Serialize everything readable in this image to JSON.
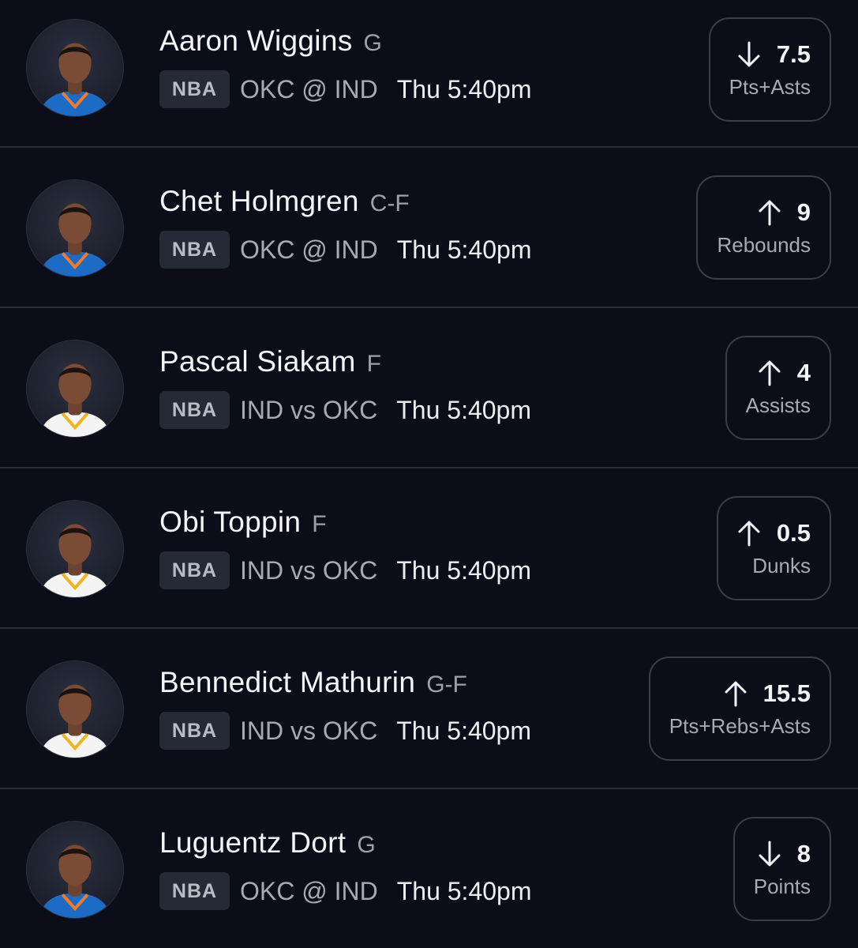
{
  "colors": {
    "background": "#0b0d18",
    "card_border": "#3a3d4a",
    "badge_bg": "#262936",
    "okc_jersey": "#1d6bc4",
    "ind_jersey": "#f4f4f4"
  },
  "players": [
    {
      "name": "Aaron Wiggins",
      "position": "G",
      "league": "NBA",
      "matchup": "OKC @ IND",
      "time": "Thu 5:40pm",
      "direction": "down",
      "arrow_icon": "arrow-down-icon",
      "value": "7.5",
      "stat": "Pts+Asts",
      "jersey": "okc"
    },
    {
      "name": "Chet Holmgren",
      "position": "C-F",
      "league": "NBA",
      "matchup": "OKC @ IND",
      "time": "Thu 5:40pm",
      "direction": "up",
      "arrow_icon": "arrow-up-icon",
      "value": "9",
      "stat": "Rebounds",
      "jersey": "okc"
    },
    {
      "name": "Pascal Siakam",
      "position": "F",
      "league": "NBA",
      "matchup": "IND vs OKC",
      "time": "Thu 5:40pm",
      "direction": "up",
      "arrow_icon": "arrow-up-icon",
      "value": "4",
      "stat": "Assists",
      "jersey": "ind"
    },
    {
      "name": "Obi Toppin",
      "position": "F",
      "league": "NBA",
      "matchup": "IND vs OKC",
      "time": "Thu 5:40pm",
      "direction": "up",
      "arrow_icon": "arrow-up-icon",
      "value": "0.5",
      "stat": "Dunks",
      "jersey": "ind"
    },
    {
      "name": "Bennedict Mathurin",
      "position": "G-F",
      "league": "NBA",
      "matchup": "IND vs OKC",
      "time": "Thu 5:40pm",
      "direction": "up",
      "arrow_icon": "arrow-up-icon",
      "value": "15.5",
      "stat": "Pts+Rebs+Asts",
      "jersey": "ind"
    },
    {
      "name": "Luguentz Dort",
      "position": "G",
      "league": "NBA",
      "matchup": "OKC @ IND",
      "time": "Thu 5:40pm",
      "direction": "down",
      "arrow_icon": "arrow-down-icon",
      "value": "8",
      "stat": "Points",
      "jersey": "okc"
    }
  ]
}
